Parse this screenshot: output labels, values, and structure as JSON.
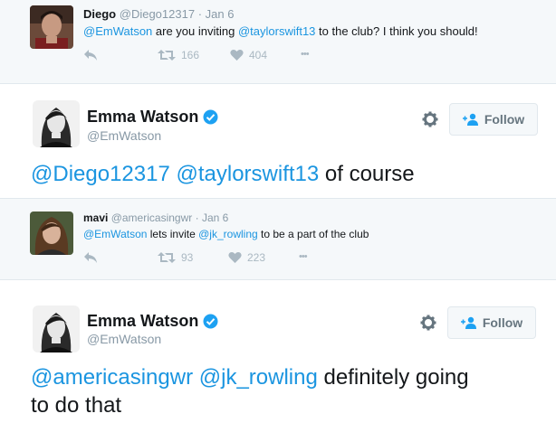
{
  "tweet1": {
    "name": "Diego",
    "handle": "@Diego12317",
    "separator": "·",
    "date": "Jan 6",
    "mention1": "@EmWatson",
    "text1": " are you inviting ",
    "mention2": "@taylorswift13",
    "text2": " to the club? I think you should!",
    "retweets": "166",
    "likes": "404",
    "more": "•••"
  },
  "main1": {
    "name": "Emma Watson",
    "handle": "@EmWatson",
    "follow_label": "Follow",
    "mention1": "@Diego12317",
    "mention2": "@taylorswift13",
    "text_end": " of course"
  },
  "tweet2": {
    "name": "mavi",
    "handle": "@americasingwr",
    "separator": "·",
    "date": "Jan 6",
    "mention1": "@EmWatson",
    "text1": " lets invite ",
    "mention2": "@jk_rowling",
    "text2": " to be a part of the club",
    "retweets": "93",
    "likes": "223",
    "more": "•••"
  },
  "main2": {
    "name": "Emma Watson",
    "handle": "@EmWatson",
    "follow_label": "Follow",
    "mention1": "@americasingwr",
    "mention2": "@jk_rowling",
    "text_line1_end": " definitely going",
    "text_line2": "to do that"
  },
  "colors": {
    "link": "#1b95e0",
    "verified": "#1da1f2",
    "muted": "#8899a6",
    "reply_bg": "#f5f8fa"
  },
  "icons": [
    "reply-icon",
    "retweet-icon",
    "heart-icon",
    "more-icon",
    "verified-icon",
    "gear-icon",
    "follow-person-icon"
  ]
}
